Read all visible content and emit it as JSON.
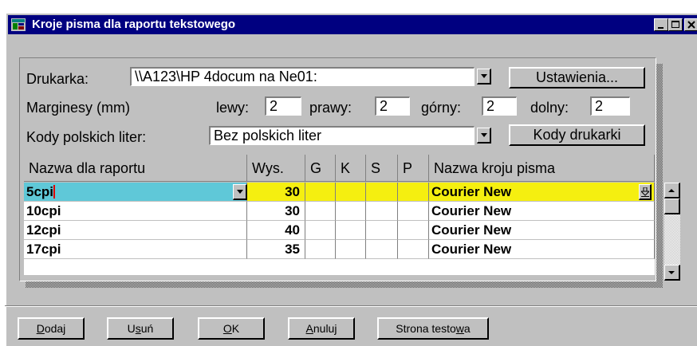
{
  "window": {
    "title": "Kroje pisma dla raportu tekstowego"
  },
  "printer": {
    "label": "Drukarka:",
    "value": "\\\\A123\\HP 4docum na Ne01:",
    "settings_button": "Ustawienia..."
  },
  "margins": {
    "label": "Marginesy (mm)",
    "left_label": "lewy:",
    "left_value": "2",
    "right_label": "prawy:",
    "right_value": "2",
    "top_label": "górny:",
    "top_value": "2",
    "bottom_label": "dolny:",
    "bottom_value": "2"
  },
  "polish_codes": {
    "label": "Kody polskich liter:",
    "value": "Bez polskich liter",
    "button": "Kody drukarki"
  },
  "table": {
    "headers": [
      "Nazwa dla raportu",
      "Wys.",
      "G",
      "K",
      "S",
      "P",
      "Nazwa kroju pisma"
    ],
    "rows": [
      {
        "name": "5cpi",
        "height": "30",
        "g": "",
        "k": "",
        "s": "",
        "p": "",
        "font": "Courier New",
        "selected": true
      },
      {
        "name": "10cpi",
        "height": "30",
        "g": "",
        "k": "",
        "s": "",
        "p": "",
        "font": "Courier New",
        "selected": false
      },
      {
        "name": "12cpi",
        "height": "40",
        "g": "",
        "k": "",
        "s": "",
        "p": "",
        "font": "Courier New",
        "selected": false
      },
      {
        "name": "17cpi",
        "height": "35",
        "g": "",
        "k": "",
        "s": "",
        "p": "",
        "font": "Courier New",
        "selected": false
      }
    ]
  },
  "buttons": {
    "add": {
      "pre": "",
      "key": "D",
      "post": "odaj"
    },
    "remove": {
      "pre": "U",
      "key": "s",
      "post": "uń"
    },
    "ok": {
      "pre": "",
      "key": "O",
      "post": "K"
    },
    "cancel": {
      "pre": "",
      "key": "A",
      "post": "nuluj"
    },
    "test_page": {
      "pre": "Strona testo",
      "key": "w",
      "post": "a"
    }
  },
  "colors": {
    "selected_name_bg": "#5fc8d8",
    "selected_row_bg": "#f5ef10",
    "title_bg": "#000080"
  }
}
